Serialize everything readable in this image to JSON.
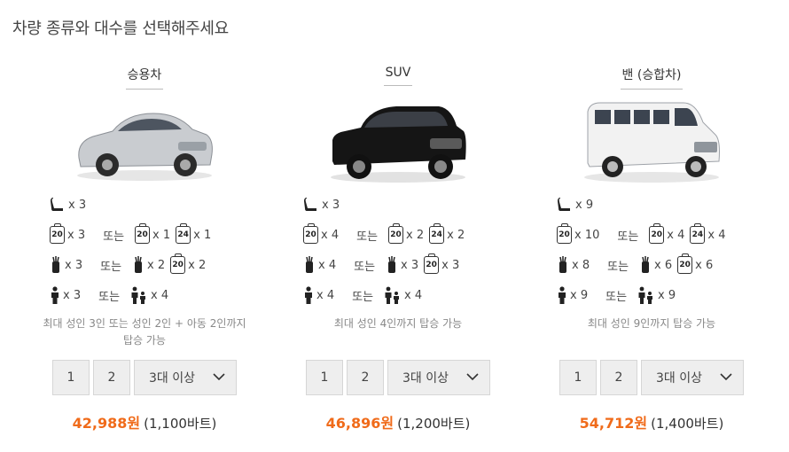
{
  "header": {
    "title": "차량 종류와 대수를 선택해주세요"
  },
  "cards": [
    {
      "title": "승용차",
      "seats": "x 3",
      "lug_a": "x 3",
      "or1": "또는",
      "lug_b": "x 1",
      "lug_c": "x 1",
      "golf_a": "x 3",
      "or2": "또는",
      "golf_b": "x 2",
      "golf_c": "x 2",
      "pax_a": "x 3",
      "or3": "또는",
      "pax_b": "x 4",
      "note": "최대 성인 3인 또는 성인 2인 + 아동 2인까지 탑승 가능",
      "opt1": "1",
      "opt2": "2",
      "opt3": "3대 이상",
      "price": "42,988원",
      "baht": "(1,100바트)"
    },
    {
      "title": "SUV",
      "seats": "x 3",
      "lug_a": "x 4",
      "or1": "또는",
      "lug_b": "x 2",
      "lug_c": "x 2",
      "golf_a": "x 4",
      "or2": "또는",
      "golf_b": "x 3",
      "golf_c": "x 3",
      "pax_a": "x 4",
      "or3": "또는",
      "pax_b": "x 4",
      "note": "최대 성인 4인까지 탑승 가능",
      "opt1": "1",
      "opt2": "2",
      "opt3": "3대 이상",
      "price": "46,896원",
      "baht": "(1,200바트)"
    },
    {
      "title": "밴 (승합차)",
      "seats": "x 9",
      "lug_a": "x 10",
      "or1": "또는",
      "lug_b": "x 4",
      "lug_c": "x 4",
      "golf_a": "x 8",
      "or2": "또는",
      "golf_b": "x 6",
      "golf_c": "x 6",
      "pax_a": "x 9",
      "or3": "또는",
      "pax_b": "x 9",
      "note": "최대 성인 9인까지 탑승 가능",
      "opt1": "1",
      "opt2": "2",
      "opt3": "3대 이상",
      "price": "54,712원",
      "baht": "(1,400바트)"
    }
  ],
  "luggage_sizes": {
    "small": "20",
    "large": "24"
  },
  "colors": {
    "price": "#f06b1a",
    "button_bg": "#eeeeee"
  }
}
